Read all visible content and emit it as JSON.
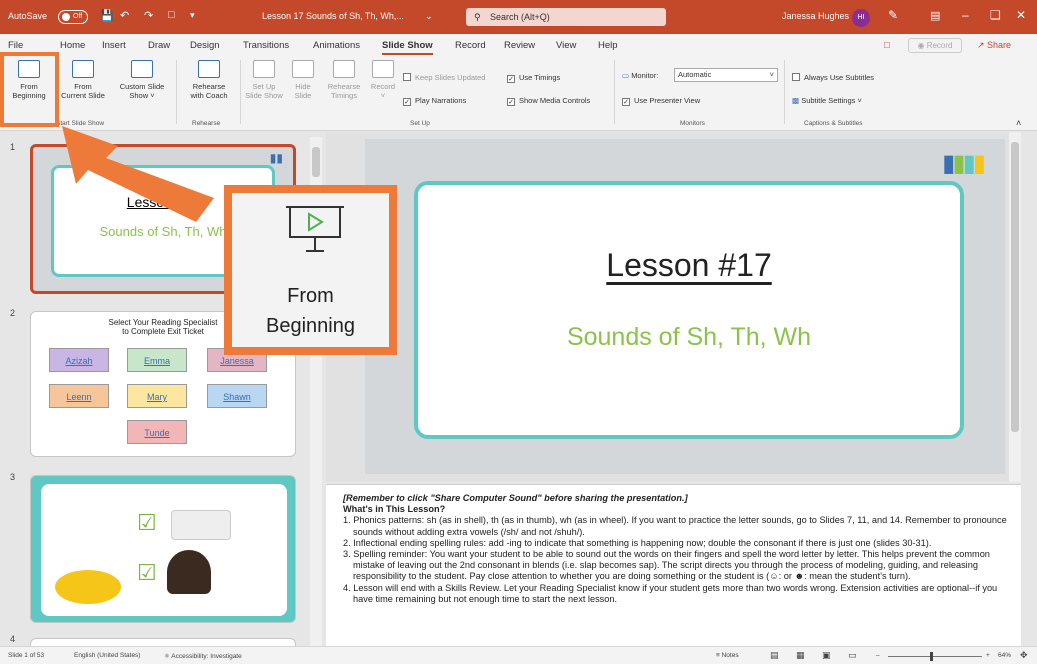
{
  "title_bar": {
    "autosave_label": "AutoSave",
    "autosave_state": "Off",
    "doc_title": "Lesson 17 Sounds of Sh, Th, Wh,...",
    "search_placeholder": "Search (Alt+Q)",
    "user_name": "Janessa Hughes",
    "user_initials": "HI"
  },
  "tabs": [
    "File",
    "Home",
    "Insert",
    "Draw",
    "Design",
    "Transitions",
    "Animations",
    "Slide Show",
    "Record",
    "Review",
    "View",
    "Help"
  ],
  "active_tab": "Slide Show",
  "record_button": "Record",
  "share_button": "Share",
  "ribbon": {
    "start": {
      "from_beginning": [
        "From",
        "Beginning"
      ],
      "from_current": [
        "From",
        "Current Slide"
      ],
      "custom_show": [
        "Custom Slide",
        "Show"
      ],
      "group": "Start Slide Show"
    },
    "rehearse": {
      "rehearse_coach": [
        "Rehearse",
        "with Coach"
      ],
      "group": "Rehearse"
    },
    "setup": {
      "set_up": [
        "Set Up",
        "Slide Show"
      ],
      "hide": [
        "Hide",
        "Slide"
      ],
      "timings": [
        "Rehearse",
        "Timings"
      ],
      "record": "Record",
      "keep_updated": "Keep Slides Updated",
      "use_timings": "Use Timings",
      "play_narrations": "Play Narrations",
      "show_media": "Show Media Controls",
      "group": "Set Up"
    },
    "monitors": {
      "monitor_label": "Monitor:",
      "monitor_value": "Automatic",
      "presenter_view": "Use Presenter View",
      "group": "Monitors"
    },
    "captions": {
      "always_subtitles": "Always Use Subtitles",
      "subtitle_settings": "Subtitle Settings",
      "group": "Captions & Subtitles"
    }
  },
  "thumbnails": {
    "slide1": {
      "num": "1",
      "title": "Lesson #17",
      "subtitle": "Sounds of Sh, Th, Wh"
    },
    "slide2": {
      "num": "2",
      "heading": [
        "Select Your Reading Specialist",
        "to Complete Exit Ticket"
      ],
      "names": [
        "Azizah",
        "Emma",
        "Janessa",
        "Leenn",
        "Mary",
        "Shawn",
        "Tunde"
      ],
      "colors": [
        "#c9b6e4",
        "#c8e6c9",
        "#e4b6c4",
        "#f6c59a",
        "#fde7a0",
        "#b9d6f2",
        "#f2b6b6"
      ]
    },
    "slide3": {
      "num": "3"
    },
    "slide4": {
      "num": "4"
    }
  },
  "slide": {
    "title": "Lesson #17",
    "subtitle": "Sounds of Sh, Th, Wh"
  },
  "notes": {
    "line0": "[Remember to click \"Share Computer Sound\" before sharing the presentation.]",
    "heading": "What's in This Lesson?",
    "items": [
      "1. Phonics patterns: sh (as in shell), th (as in thumb), wh (as in wheel). If you want to practice the letter sounds, go to Slides 7, 11, and 14. Remember to pronounce sounds without adding extra vowels (/sh/ and not /shuh/).",
      "2. Inflectional ending spelling rules: add -ing to indicate that something is happening now; double the consonant if there is just one (slides 30-31).",
      "3. Spelling reminder: You want your student to be able to sound out the words on their fingers and spell the word letter by letter. This helps prevent the common mistake of leaving out the 2nd consonant in blends (i.e. slap becomes sap). The script directs you through the process of modeling, guiding, and releasing responsibility to the student. Pay close attention to whether you are doing something or the student is (☺: or ☻: mean the student's turn).",
      "4. Lesson will end with a Skills Review. Let your Reading Specialist know if your student gets more than two words wrong. Extension activities are optional--if you have time remaining but not enough time to start the next lesson."
    ]
  },
  "status": {
    "slide_count": "Slide 1 of 53",
    "language": "English (United States)",
    "accessibility": "Accessibility: Investigate",
    "notes_label": "Notes",
    "zoom": "64%"
  },
  "callout": {
    "line1": "From",
    "line2": "Beginning"
  },
  "colors": {
    "accent": "#c4482a",
    "callout": "#ee7a3a",
    "teal": "#5fc8c2",
    "green": "#8bc34a"
  }
}
